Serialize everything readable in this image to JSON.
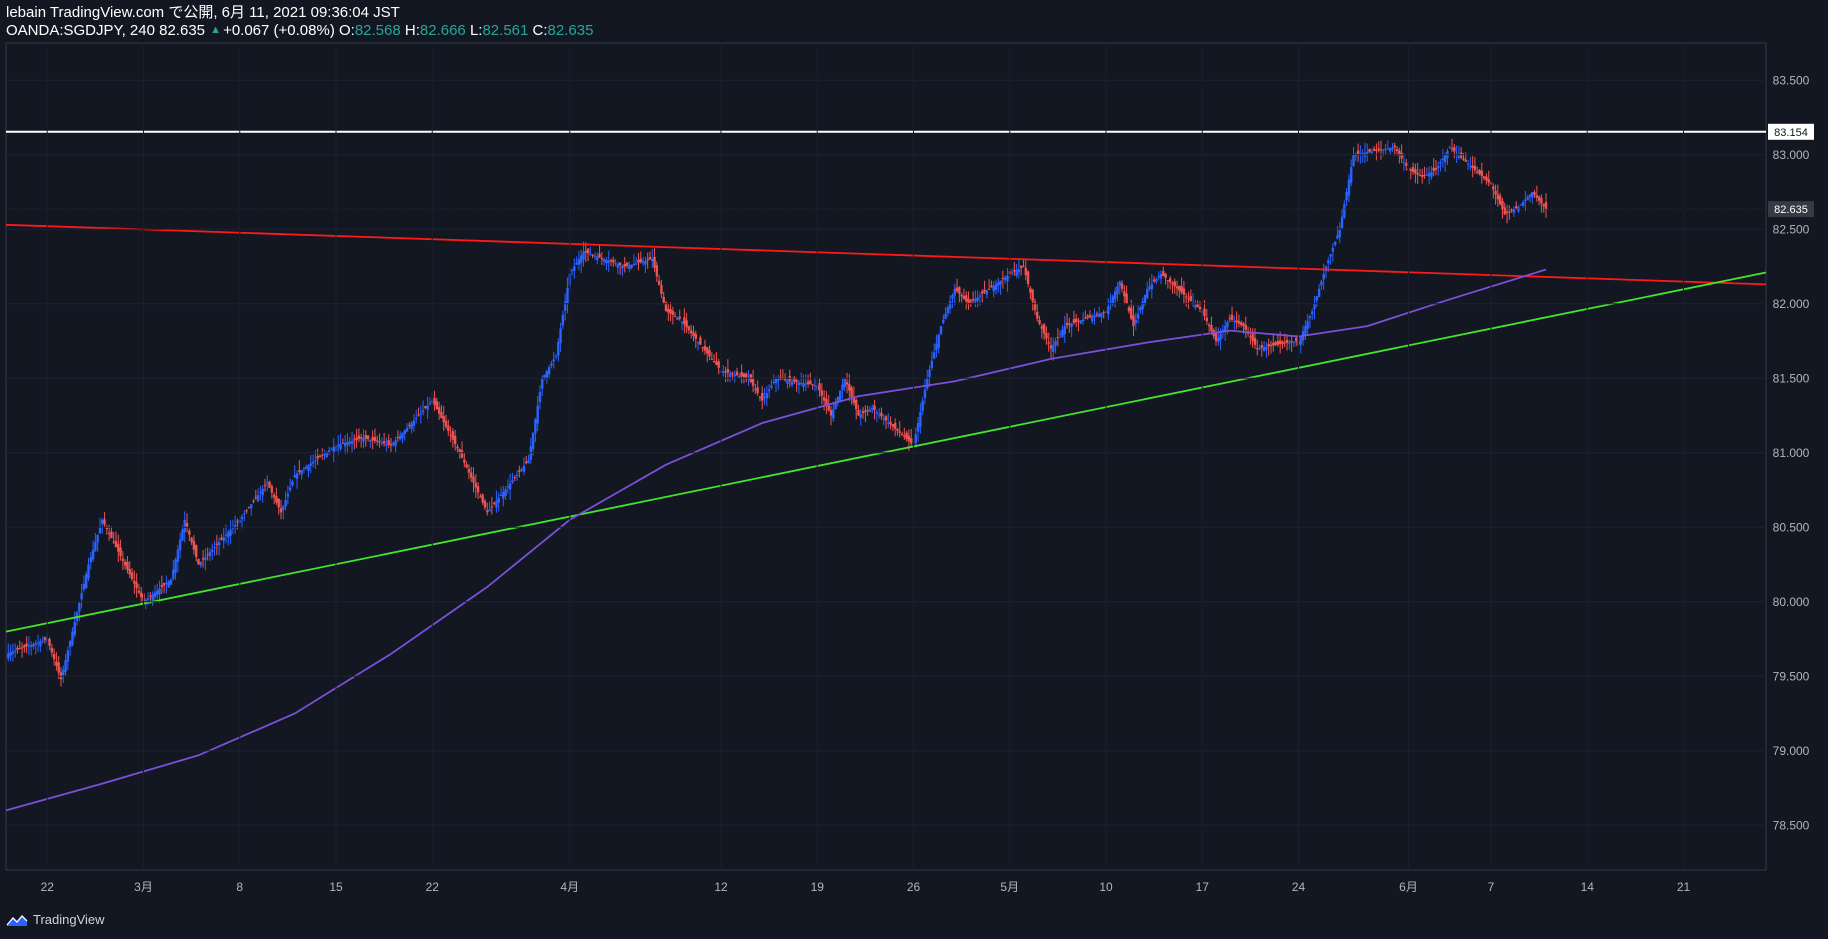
{
  "header": {
    "line1": "lebain TradingView.com で公開, 6月 11, 2021 09:36:04 JST",
    "symbol": "OANDA:SGDJPY, 240 82.635",
    "change": "+0.067 (+0.08%)",
    "o_label": "O:",
    "o_value": "82.568",
    "h_label": "H:",
    "h_value": "82.666",
    "l_label": "L:",
    "l_value": "82.561",
    "c_label": "C:",
    "c_value": "82.635"
  },
  "brand": {
    "name": "TradingView"
  },
  "chart_data": {
    "type": "candlestick",
    "symbol": "OANDA:SGDJPY",
    "timeframe": "240",
    "ylim": [
      78.2,
      83.75
    ],
    "y_ticks": [
      "83.500",
      "83.000",
      "82.500",
      "82.000",
      "81.500",
      "81.000",
      "80.500",
      "80.000",
      "79.500",
      "79.000",
      "78.500"
    ],
    "x_ticks": [
      "22",
      "3月",
      "8",
      "15",
      "22",
      "4月",
      "12",
      "19",
      "26",
      "5月",
      "10",
      "17",
      "24",
      "6月",
      "7",
      "14",
      "21"
    ],
    "x_range": [
      "2021-02-19",
      "2021-06-27"
    ],
    "x_tick_dates": [
      "2021-02-22",
      "2021-03-01",
      "2021-03-08",
      "2021-03-15",
      "2021-03-22",
      "2021-04-01",
      "2021-04-12",
      "2021-04-19",
      "2021-04-26",
      "2021-05-03",
      "2021-05-10",
      "2021-05-17",
      "2021-05-24",
      "2021-06-01",
      "2021-06-07",
      "2021-06-14",
      "2021-06-21"
    ],
    "last_price": "82.635",
    "horizontal_line": {
      "value": "83.154",
      "color": "#ffffff"
    },
    "trendlines": [
      {
        "name": "resistance",
        "color": "#ff1a1a",
        "from": [
          "2021-02-19",
          82.53
        ],
        "to": [
          "2021-06-27",
          82.13
        ]
      },
      {
        "name": "support",
        "color": "#44e62b",
        "from": [
          "2021-02-19",
          79.8
        ],
        "to": [
          "2021-06-27",
          82.21
        ]
      }
    ],
    "moving_average": {
      "color": "#7b4fd8",
      "points": [
        [
          "2021-02-19",
          78.6
        ],
        [
          "2021-02-26",
          78.78
        ],
        [
          "2021-03-05",
          78.97
        ],
        [
          "2021-03-12",
          79.25
        ],
        [
          "2021-03-19",
          79.65
        ],
        [
          "2021-03-26",
          80.1
        ],
        [
          "2021-04-01",
          80.55
        ],
        [
          "2021-04-08",
          80.92
        ],
        [
          "2021-04-15",
          81.2
        ],
        [
          "2021-04-22",
          81.38
        ],
        [
          "2021-04-29",
          81.48
        ],
        [
          "2021-05-06",
          81.63
        ],
        [
          "2021-05-13",
          81.74
        ],
        [
          "2021-05-19",
          81.82
        ],
        [
          "2021-05-24",
          81.78
        ],
        [
          "2021-05-29",
          81.85
        ],
        [
          "2021-06-04",
          82.03
        ],
        [
          "2021-06-11",
          82.23
        ]
      ]
    },
    "anchors": [
      [
        "2021-02-19",
        79.65
      ],
      [
        "2021-02-22",
        79.75
      ],
      [
        "2021-02-23",
        79.48
      ],
      [
        "2021-02-25",
        80.25
      ],
      [
        "2021-02-26",
        80.55
      ],
      [
        "2021-03-01",
        80.0
      ],
      [
        "2021-03-03",
        80.15
      ],
      [
        "2021-03-04",
        80.55
      ],
      [
        "2021-03-05",
        80.25
      ],
      [
        "2021-03-08",
        80.55
      ],
      [
        "2021-03-10",
        80.8
      ],
      [
        "2021-03-11",
        80.6
      ],
      [
        "2021-03-12",
        80.85
      ],
      [
        "2021-03-15",
        81.05
      ],
      [
        "2021-03-17",
        81.1
      ],
      [
        "2021-03-19",
        81.05
      ],
      [
        "2021-03-22",
        81.35
      ],
      [
        "2021-03-24",
        81.0
      ],
      [
        "2021-03-26",
        80.6
      ],
      [
        "2021-03-29",
        80.95
      ],
      [
        "2021-03-30",
        81.5
      ],
      [
        "2021-03-31",
        81.65
      ],
      [
        "2021-04-01",
        82.2
      ],
      [
        "2021-04-02",
        82.35
      ],
      [
        "2021-04-05",
        82.25
      ],
      [
        "2021-04-07",
        82.3
      ],
      [
        "2021-04-08",
        81.95
      ],
      [
        "2021-04-09",
        81.9
      ],
      [
        "2021-04-12",
        81.55
      ],
      [
        "2021-04-14",
        81.5
      ],
      [
        "2021-04-15",
        81.35
      ],
      [
        "2021-04-16",
        81.5
      ],
      [
        "2021-04-19",
        81.45
      ],
      [
        "2021-04-20",
        81.25
      ],
      [
        "2021-04-21",
        81.5
      ],
      [
        "2021-04-22",
        81.25
      ],
      [
        "2021-04-23",
        81.3
      ],
      [
        "2021-04-26",
        81.05
      ],
      [
        "2021-04-27",
        81.5
      ],
      [
        "2021-04-28",
        81.85
      ],
      [
        "2021-04-29",
        82.1
      ],
      [
        "2021-04-30",
        82.0
      ],
      [
        "2021-05-03",
        82.2
      ],
      [
        "2021-05-04",
        82.25
      ],
      [
        "2021-05-05",
        81.9
      ],
      [
        "2021-05-06",
        81.7
      ],
      [
        "2021-05-07",
        81.85
      ],
      [
        "2021-05-10",
        81.95
      ],
      [
        "2021-05-11",
        82.15
      ],
      [
        "2021-05-12",
        81.85
      ],
      [
        "2021-05-13",
        82.1
      ],
      [
        "2021-05-14",
        82.2
      ],
      [
        "2021-05-17",
        81.95
      ],
      [
        "2021-05-18",
        81.75
      ],
      [
        "2021-05-19",
        81.9
      ],
      [
        "2021-05-20",
        81.85
      ],
      [
        "2021-05-21",
        81.7
      ],
      [
        "2021-05-24",
        81.75
      ],
      [
        "2021-05-25",
        81.95
      ],
      [
        "2021-05-26",
        82.25
      ],
      [
        "2021-05-27",
        82.5
      ],
      [
        "2021-05-28",
        83.0
      ],
      [
        "2021-05-31",
        83.05
      ],
      [
        "2021-06-01",
        82.9
      ],
      [
        "2021-06-02",
        82.85
      ],
      [
        "2021-06-03",
        82.9
      ],
      [
        "2021-06-04",
        83.05
      ],
      [
        "2021-06-07",
        82.8
      ],
      [
        "2021-06-08",
        82.6
      ],
      [
        "2021-06-09",
        82.65
      ],
      [
        "2021-06-10",
        82.75
      ],
      [
        "2021-06-11",
        82.635
      ]
    ],
    "colors": {
      "up": "#2962ff",
      "down": "#ef5350",
      "background": "#131722"
    }
  }
}
